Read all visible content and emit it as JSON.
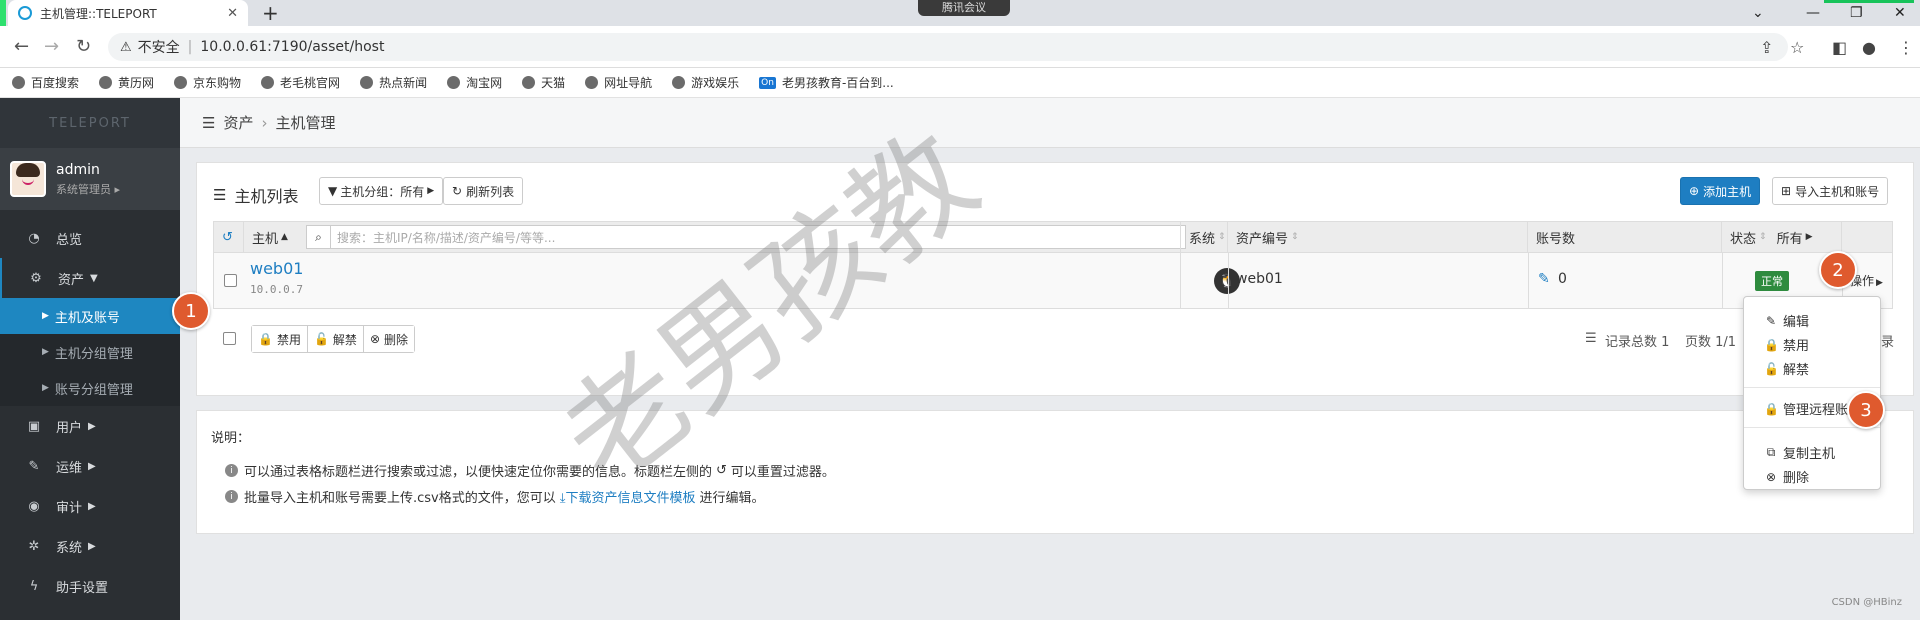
{
  "browser": {
    "tab_title": "主机管理::TELEPORT",
    "tab_close": "✕",
    "new_tab": "+",
    "meeting": "腾讯会议",
    "security_label": "不安全",
    "url": "10.0.0.61:7190/asset/host",
    "bookmarks": [
      "百度搜索",
      "黄历网",
      "京东购物",
      "老毛桃官网",
      "热点新闻",
      "淘宝网",
      "天猫",
      "网址导航",
      "游戏娱乐",
      "老男孩教育-百台到..."
    ],
    "bookmark_on_badge": "On"
  },
  "sidebar": {
    "logo": "TELEPORT",
    "user_name": "admin",
    "user_role": "系统管理员",
    "items": [
      {
        "label": "总览",
        "icon": "dashboard-icon"
      },
      {
        "label": "资产",
        "icon": "assets-icon"
      },
      {
        "label": "用户",
        "icon": "user-icon"
      },
      {
        "label": "运维",
        "icon": "wrench-icon"
      },
      {
        "label": "审计",
        "icon": "eye-icon"
      },
      {
        "label": "系统",
        "icon": "gear-icon"
      },
      {
        "label": "助手设置",
        "icon": "bolt-icon"
      }
    ],
    "subitems": [
      "主机及账号",
      "主机分组管理",
      "账号分组管理"
    ]
  },
  "breadcrumb": {
    "root": "资产",
    "current": "主机管理"
  },
  "host_panel": {
    "title": "主机列表",
    "group_filter": "主机分组：所有",
    "refresh": "刷新列表",
    "add_host": "添加主机",
    "import": "导入主机和账号",
    "columns": {
      "host": "主机",
      "search_placeholder": "搜索：主机IP/名称/描述/资产编号/等等...",
      "os": "系统",
      "asset_no": "资产编号",
      "accounts": "账号数",
      "status": "状态",
      "status_filter": "所有"
    },
    "rows": [
      {
        "name": "web01",
        "ip": "10.0.0.7",
        "asset_no": "web01",
        "accounts": "0",
        "status": "正常",
        "action": "操作"
      }
    ],
    "bulk": {
      "disable": "禁用",
      "enable": "解禁",
      "delete": "删除"
    },
    "pager": {
      "total": "记录总数 1",
      "pages": "页数 1/1",
      "tail": "录"
    }
  },
  "action_menu": {
    "edit": "编辑",
    "disable": "禁用",
    "enable": "解禁",
    "manage_remote": "管理远程账",
    "copy_host": "复制主机",
    "delete": "删除"
  },
  "notes": {
    "title": "说明：",
    "line1": "可以通过表格标题栏进行搜索或过滤，以便快速定位你需要的信息。标题栏左侧的",
    "line1_tail": "可以重置过滤器。",
    "line2": "批量导入主机和账号需要上传.csv格式的文件，您可以",
    "line2_link": "下载资产信息文件模板",
    "line2_tail": "进行编辑。"
  },
  "annotations": [
    "1",
    "2",
    "3"
  ],
  "watermark": "老男孩教",
  "credit": "CSDN @HBinz"
}
